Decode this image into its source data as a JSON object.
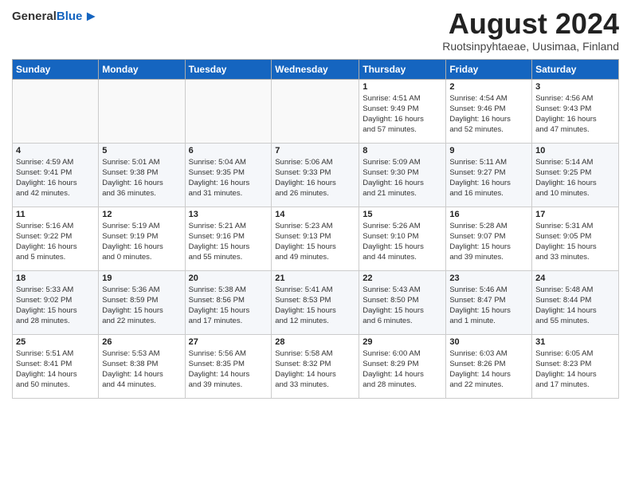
{
  "header": {
    "logo_general": "General",
    "logo_blue": "Blue",
    "month_title": "August 2024",
    "location": "Ruotsinpyhtaeae, Uusimaa, Finland"
  },
  "weekdays": [
    "Sunday",
    "Monday",
    "Tuesday",
    "Wednesday",
    "Thursday",
    "Friday",
    "Saturday"
  ],
  "weeks": [
    [
      {
        "day": "",
        "info": ""
      },
      {
        "day": "",
        "info": ""
      },
      {
        "day": "",
        "info": ""
      },
      {
        "day": "",
        "info": ""
      },
      {
        "day": "1",
        "info": "Sunrise: 4:51 AM\nSunset: 9:49 PM\nDaylight: 16 hours\nand 57 minutes."
      },
      {
        "day": "2",
        "info": "Sunrise: 4:54 AM\nSunset: 9:46 PM\nDaylight: 16 hours\nand 52 minutes."
      },
      {
        "day": "3",
        "info": "Sunrise: 4:56 AM\nSunset: 9:43 PM\nDaylight: 16 hours\nand 47 minutes."
      }
    ],
    [
      {
        "day": "4",
        "info": "Sunrise: 4:59 AM\nSunset: 9:41 PM\nDaylight: 16 hours\nand 42 minutes."
      },
      {
        "day": "5",
        "info": "Sunrise: 5:01 AM\nSunset: 9:38 PM\nDaylight: 16 hours\nand 36 minutes."
      },
      {
        "day": "6",
        "info": "Sunrise: 5:04 AM\nSunset: 9:35 PM\nDaylight: 16 hours\nand 31 minutes."
      },
      {
        "day": "7",
        "info": "Sunrise: 5:06 AM\nSunset: 9:33 PM\nDaylight: 16 hours\nand 26 minutes."
      },
      {
        "day": "8",
        "info": "Sunrise: 5:09 AM\nSunset: 9:30 PM\nDaylight: 16 hours\nand 21 minutes."
      },
      {
        "day": "9",
        "info": "Sunrise: 5:11 AM\nSunset: 9:27 PM\nDaylight: 16 hours\nand 16 minutes."
      },
      {
        "day": "10",
        "info": "Sunrise: 5:14 AM\nSunset: 9:25 PM\nDaylight: 16 hours\nand 10 minutes."
      }
    ],
    [
      {
        "day": "11",
        "info": "Sunrise: 5:16 AM\nSunset: 9:22 PM\nDaylight: 16 hours\nand 5 minutes."
      },
      {
        "day": "12",
        "info": "Sunrise: 5:19 AM\nSunset: 9:19 PM\nDaylight: 16 hours\nand 0 minutes."
      },
      {
        "day": "13",
        "info": "Sunrise: 5:21 AM\nSunset: 9:16 PM\nDaylight: 15 hours\nand 55 minutes."
      },
      {
        "day": "14",
        "info": "Sunrise: 5:23 AM\nSunset: 9:13 PM\nDaylight: 15 hours\nand 49 minutes."
      },
      {
        "day": "15",
        "info": "Sunrise: 5:26 AM\nSunset: 9:10 PM\nDaylight: 15 hours\nand 44 minutes."
      },
      {
        "day": "16",
        "info": "Sunrise: 5:28 AM\nSunset: 9:07 PM\nDaylight: 15 hours\nand 39 minutes."
      },
      {
        "day": "17",
        "info": "Sunrise: 5:31 AM\nSunset: 9:05 PM\nDaylight: 15 hours\nand 33 minutes."
      }
    ],
    [
      {
        "day": "18",
        "info": "Sunrise: 5:33 AM\nSunset: 9:02 PM\nDaylight: 15 hours\nand 28 minutes."
      },
      {
        "day": "19",
        "info": "Sunrise: 5:36 AM\nSunset: 8:59 PM\nDaylight: 15 hours\nand 22 minutes."
      },
      {
        "day": "20",
        "info": "Sunrise: 5:38 AM\nSunset: 8:56 PM\nDaylight: 15 hours\nand 17 minutes."
      },
      {
        "day": "21",
        "info": "Sunrise: 5:41 AM\nSunset: 8:53 PM\nDaylight: 15 hours\nand 12 minutes."
      },
      {
        "day": "22",
        "info": "Sunrise: 5:43 AM\nSunset: 8:50 PM\nDaylight: 15 hours\nand 6 minutes."
      },
      {
        "day": "23",
        "info": "Sunrise: 5:46 AM\nSunset: 8:47 PM\nDaylight: 15 hours\nand 1 minute."
      },
      {
        "day": "24",
        "info": "Sunrise: 5:48 AM\nSunset: 8:44 PM\nDaylight: 14 hours\nand 55 minutes."
      }
    ],
    [
      {
        "day": "25",
        "info": "Sunrise: 5:51 AM\nSunset: 8:41 PM\nDaylight: 14 hours\nand 50 minutes."
      },
      {
        "day": "26",
        "info": "Sunrise: 5:53 AM\nSunset: 8:38 PM\nDaylight: 14 hours\nand 44 minutes."
      },
      {
        "day": "27",
        "info": "Sunrise: 5:56 AM\nSunset: 8:35 PM\nDaylight: 14 hours\nand 39 minutes."
      },
      {
        "day": "28",
        "info": "Sunrise: 5:58 AM\nSunset: 8:32 PM\nDaylight: 14 hours\nand 33 minutes."
      },
      {
        "day": "29",
        "info": "Sunrise: 6:00 AM\nSunset: 8:29 PM\nDaylight: 14 hours\nand 28 minutes."
      },
      {
        "day": "30",
        "info": "Sunrise: 6:03 AM\nSunset: 8:26 PM\nDaylight: 14 hours\nand 22 minutes."
      },
      {
        "day": "31",
        "info": "Sunrise: 6:05 AM\nSunset: 8:23 PM\nDaylight: 14 hours\nand 17 minutes."
      }
    ]
  ]
}
